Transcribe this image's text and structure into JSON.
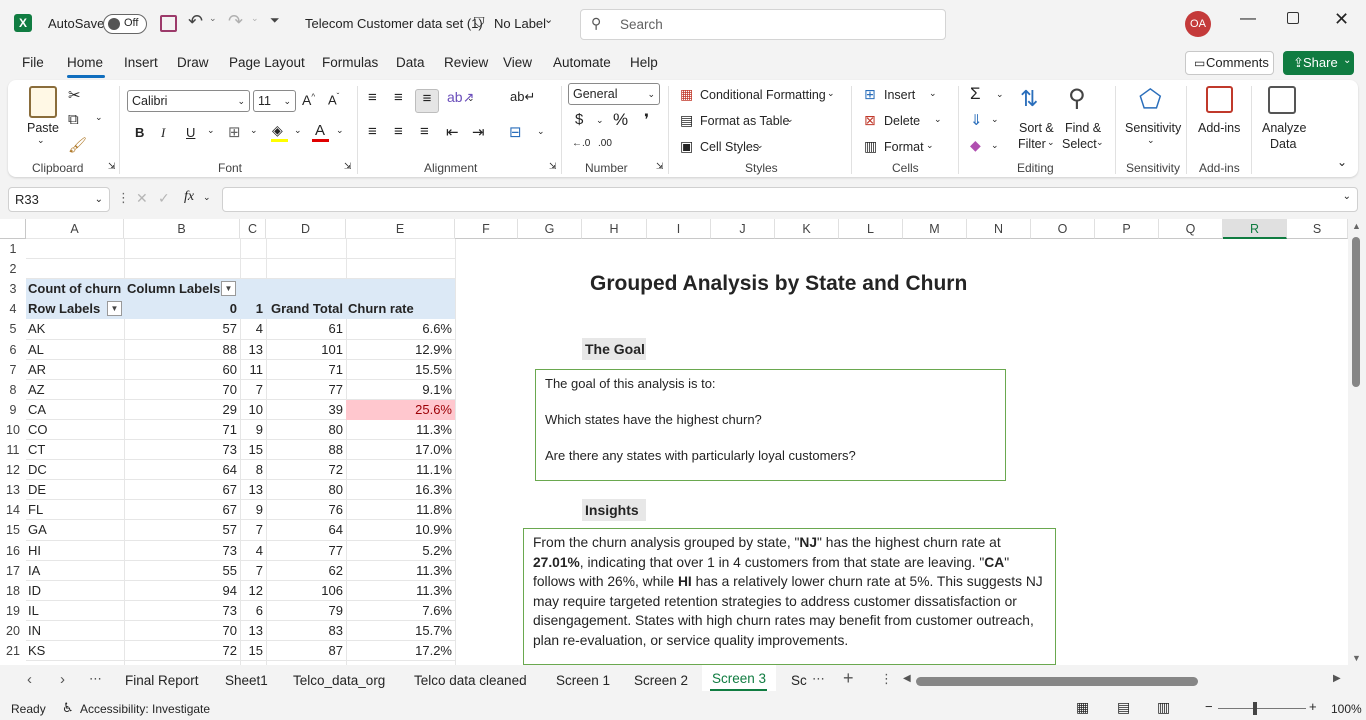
{
  "titlebar": {
    "autosave": "AutoSave",
    "toggle": "Off",
    "filename": "Telecom Customer data set (1)",
    "label": "No Label",
    "search_placeholder": "Search",
    "avatar": "OA"
  },
  "menu": [
    "File",
    "Home",
    "Insert",
    "Draw",
    "Page Layout",
    "Formulas",
    "Data",
    "Review",
    "View",
    "Automate",
    "Help"
  ],
  "comments": "Comments",
  "share": "Share",
  "ribbon": {
    "paste": "Paste",
    "clipboard": "Clipboard",
    "font_name": "Calibri",
    "font_size": "11",
    "font": "Font",
    "alignment": "Alignment",
    "number_format": "General",
    "number": "Number",
    "cond_format": "Conditional Formatting",
    "format_table": "Format as Table",
    "cell_styles": "Cell Styles",
    "styles": "Styles",
    "insert": "Insert",
    "delete": "Delete",
    "format": "Format",
    "cells": "Cells",
    "sort_filter_1": "Sort &",
    "sort_filter_2": "Filter",
    "find_1": "Find &",
    "find_2": "Select",
    "editing": "Editing",
    "sensitivity": "Sensitivity",
    "sensitivity_grp": "Sensitivity",
    "addins": "Add-ins",
    "addins_grp": "Add-ins",
    "analyze_1": "Analyze",
    "analyze_2": "Data"
  },
  "namebox": "R33",
  "columns": [
    "A",
    "B",
    "C",
    "D",
    "E",
    "F",
    "G",
    "H",
    "I",
    "J",
    "K",
    "L",
    "M",
    "N",
    "O",
    "P",
    "Q",
    "R",
    "S"
  ],
  "rows": [
    "1",
    "2",
    "3",
    "4",
    "5",
    "6",
    "7",
    "8",
    "9",
    "10",
    "11",
    "12",
    "13",
    "14",
    "15",
    "16",
    "17",
    "18",
    "19",
    "20",
    "21"
  ],
  "pivot": {
    "count_label": "Count of churn",
    "column_labels": "Column Labels",
    "row_labels": "Row Labels",
    "col0": "0",
    "col1": "1",
    "grand_total": "Grand Total",
    "churn_rate": "Churn rate",
    "data": [
      [
        "AK",
        "57",
        "4",
        "61",
        "6.6%"
      ],
      [
        "AL",
        "88",
        "13",
        "101",
        "12.9%"
      ],
      [
        "AR",
        "60",
        "11",
        "71",
        "15.5%"
      ],
      [
        "AZ",
        "70",
        "7",
        "77",
        "9.1%"
      ],
      [
        "CA",
        "29",
        "10",
        "39",
        "25.6%"
      ],
      [
        "CO",
        "71",
        "9",
        "80",
        "11.3%"
      ],
      [
        "CT",
        "73",
        "15",
        "88",
        "17.0%"
      ],
      [
        "DC",
        "64",
        "8",
        "72",
        "11.1%"
      ],
      [
        "DE",
        "67",
        "13",
        "80",
        "16.3%"
      ],
      [
        "FL",
        "67",
        "9",
        "76",
        "11.8%"
      ],
      [
        "GA",
        "57",
        "7",
        "64",
        "10.9%"
      ],
      [
        "HI",
        "73",
        "4",
        "77",
        "5.2%"
      ],
      [
        "IA",
        "55",
        "7",
        "62",
        "11.3%"
      ],
      [
        "ID",
        "94",
        "12",
        "106",
        "11.3%"
      ],
      [
        "IL",
        "73",
        "6",
        "79",
        "7.6%"
      ],
      [
        "IN",
        "70",
        "13",
        "83",
        "15.7%"
      ],
      [
        "KS",
        "72",
        "15",
        "87",
        "17.2%"
      ]
    ],
    "highlight_color": "#ffc7ce"
  },
  "report": {
    "title": "Grouped Analysis by State and Churn",
    "goal_heading": "The Goal",
    "goal_lines": [
      "The goal of this analysis is to:",
      "Which states have the highest churn?",
      "Are there any states with particularly loyal customers?"
    ],
    "insights_heading": "Insights",
    "insights": {
      "p1": "From the churn analysis grouped by state, \"",
      "nj": "NJ",
      "p2": "\" has the highest churn rate at ",
      "pct": "27.01%",
      "p3": ", indicating that over 1 in 4 customers from that state are leaving. \"",
      "ca": "CA",
      "p4": "\" follows with 26%, while ",
      "hi": "HI",
      "p5": " has a relatively lower churn rate at 5%. This suggests NJ may require targeted retention strategies to address customer dissatisfaction or disengagement. States with high churn rates may benefit from customer outreach, plan re-evaluation, or service quality improvements."
    }
  },
  "sheet_tabs": [
    "Final Report",
    "Sheet1",
    "Telco_data_org",
    "Telco data cleaned",
    "Screen 1",
    "Screen 2",
    "Screen 3",
    "Sc"
  ],
  "active_tab": "Screen 3",
  "status": {
    "ready": "Ready",
    "accessibility": "Accessibility: Investigate",
    "zoom": "100%"
  },
  "colors": {
    "excel_green": "#107c41",
    "accent_blue": "#106ebe",
    "pivot_header": "#dce9f6",
    "box_border": "#6aa84f"
  }
}
